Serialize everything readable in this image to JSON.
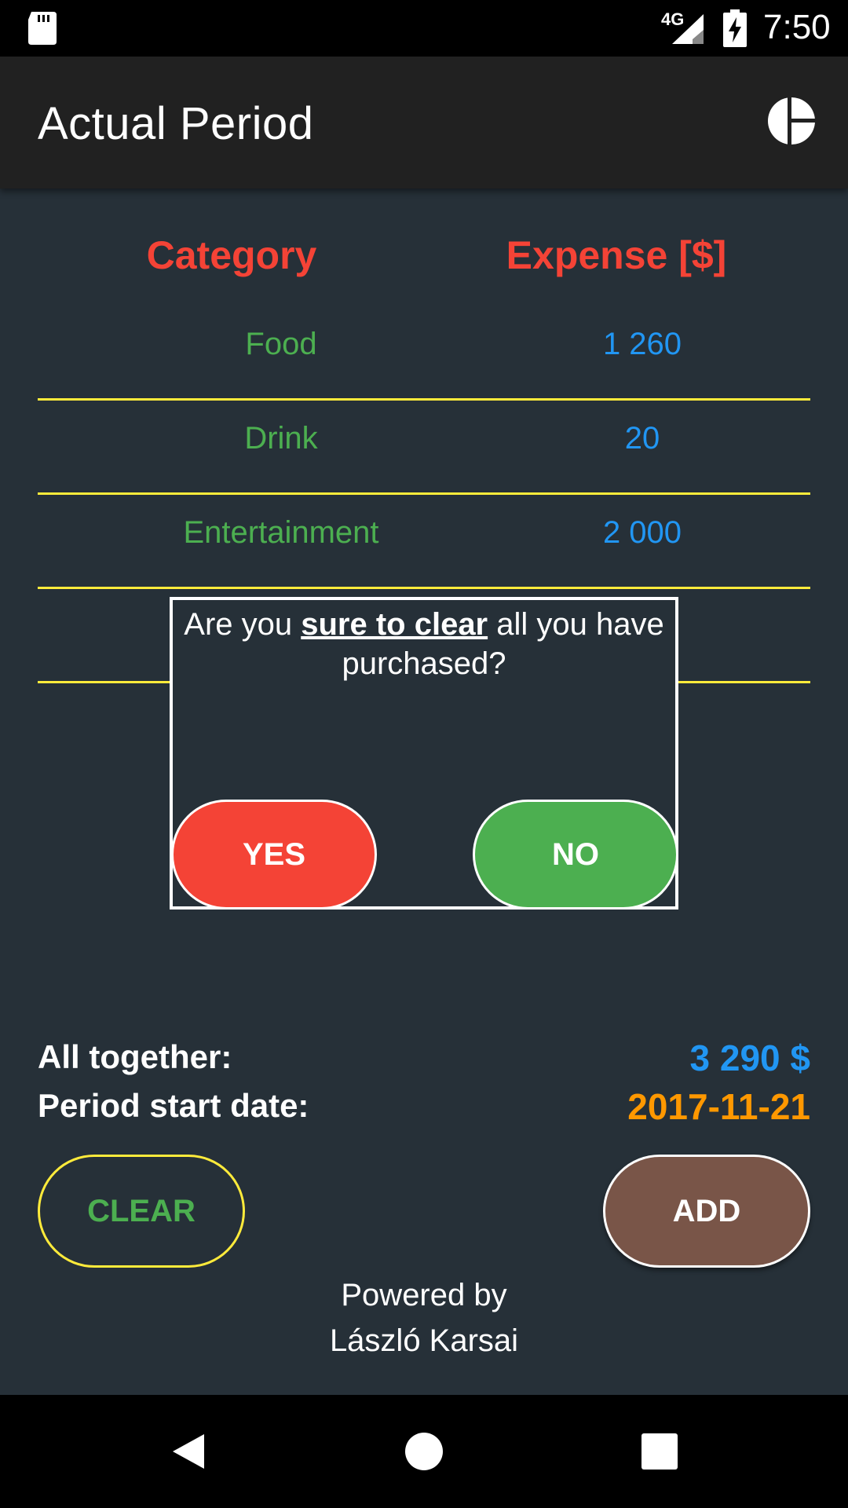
{
  "status_bar": {
    "network": "4G",
    "time": "7:50",
    "icons": [
      "sd-card-icon",
      "signal-icon",
      "battery-charging-icon"
    ]
  },
  "app_bar": {
    "title": "Actual Period",
    "action_icon": "pie-chart-icon"
  },
  "table": {
    "headers": {
      "category": "Category",
      "expense": "Expense [$]"
    },
    "rows": [
      {
        "category": "Food",
        "expense": "1 260"
      },
      {
        "category": "Drink",
        "expense": "20"
      },
      {
        "category": "Entertainment",
        "expense": "2 000"
      },
      {
        "category": "",
        "expense": ""
      }
    ]
  },
  "dialog": {
    "message_prefix": "Are you ",
    "message_emphasis": "sure to clear",
    "message_suffix": " all you have purchased?",
    "yes_label": "YES",
    "no_label": "NO"
  },
  "summary": {
    "total_label": "All together:",
    "total_value": "3 290 $",
    "start_label": "Period start date:",
    "start_value": "2017-11-21"
  },
  "actions": {
    "clear_label": "CLEAR",
    "add_label": "ADD"
  },
  "footer": {
    "line1": "Powered by",
    "line2": "László Karsai"
  },
  "nav_bar": {
    "icons": [
      "back-icon",
      "home-icon",
      "recents-icon"
    ]
  },
  "colors": {
    "background": "#263038",
    "app_bar": "#212121",
    "header_text": "#f44336",
    "category_text": "#4caf50",
    "expense_text": "#2196f3",
    "divider": "#ffeb3b",
    "yes_button": "#f44336",
    "no_button": "#4caf50",
    "add_button": "#795548",
    "total_value": "#2196f3",
    "date_value": "#ff9800"
  }
}
